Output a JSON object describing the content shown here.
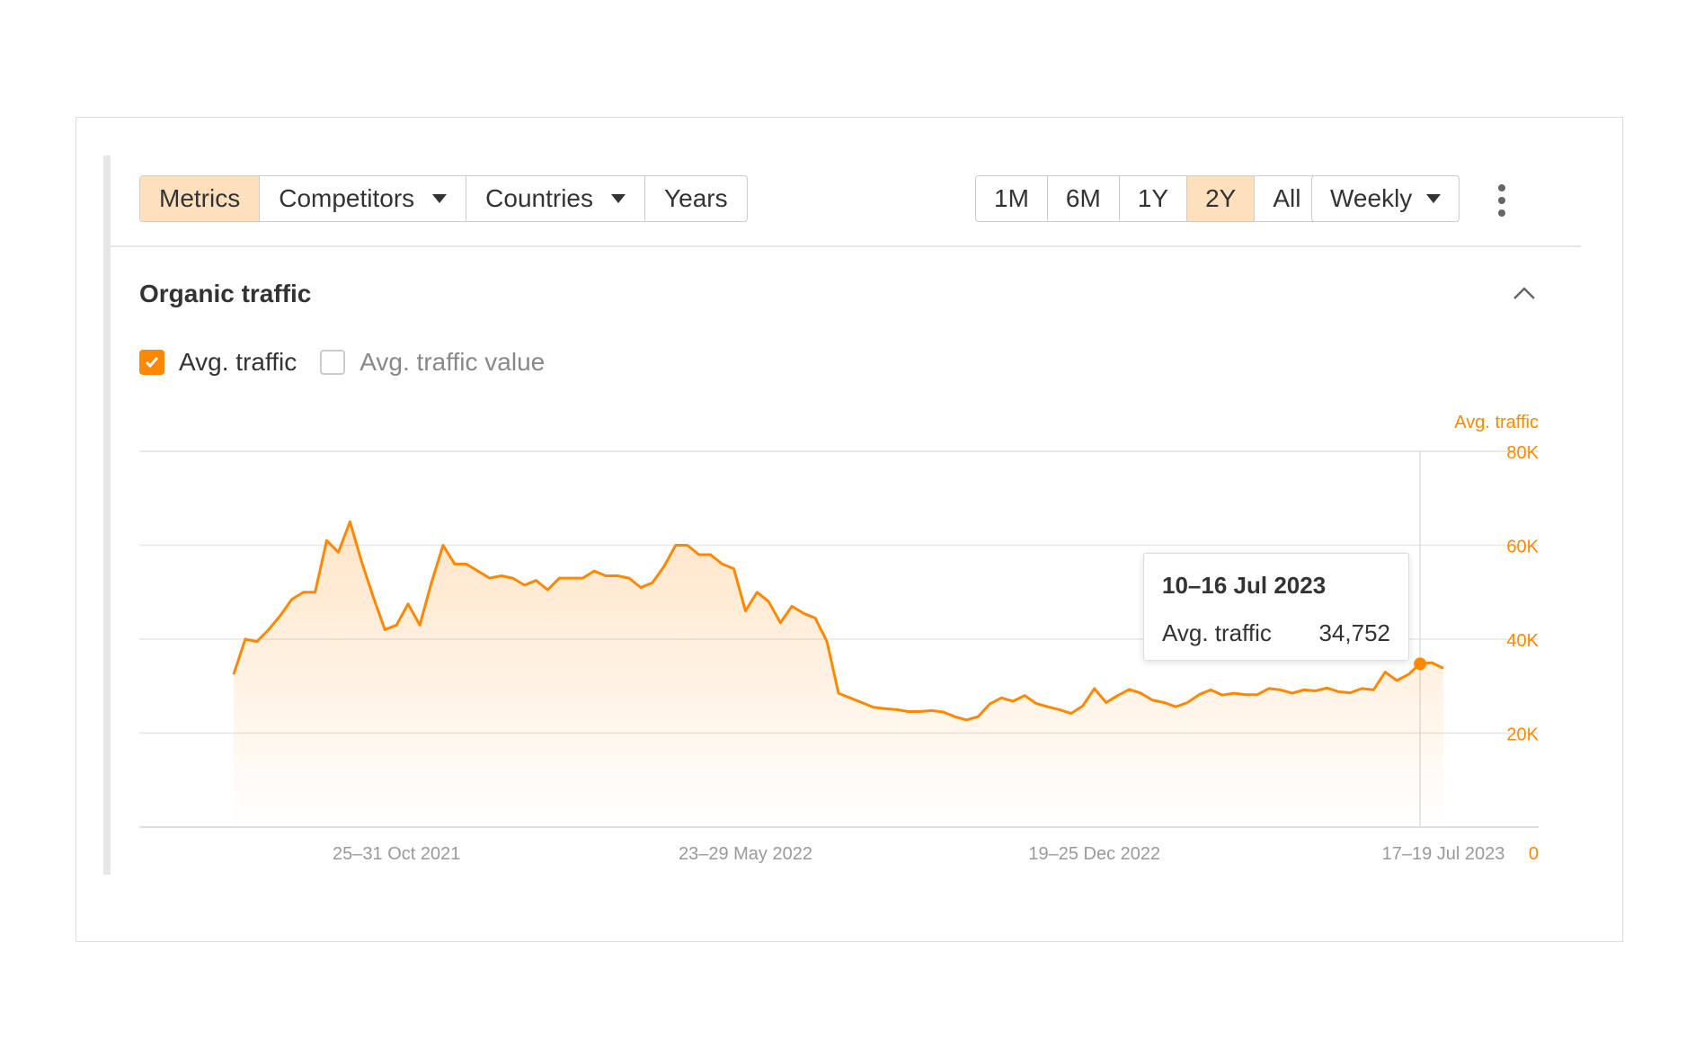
{
  "toolbar": {
    "tabs": [
      {
        "label": "Metrics",
        "active": true,
        "dropdown": false
      },
      {
        "label": "Competitors",
        "active": false,
        "dropdown": true
      },
      {
        "label": "Countries",
        "active": false,
        "dropdown": true
      },
      {
        "label": "Years",
        "active": false,
        "dropdown": false
      }
    ],
    "ranges": [
      {
        "label": "1M",
        "active": false
      },
      {
        "label": "6M",
        "active": false
      },
      {
        "label": "1Y",
        "active": false
      },
      {
        "label": "2Y",
        "active": true
      },
      {
        "label": "All",
        "active": false
      }
    ],
    "interval": "Weekly",
    "more_icon": "vertical-ellipsis-icon"
  },
  "section": {
    "title": "Organic traffic",
    "collapse_icon": "chevron-up-icon"
  },
  "checkboxes": [
    {
      "label": "Avg. traffic",
      "checked": true
    },
    {
      "label": "Avg. traffic value",
      "checked": false
    }
  ],
  "tooltip": {
    "date": "10–16 Jul 2023",
    "label": "Avg. traffic",
    "value": "34,752"
  },
  "colors": {
    "accent": "#ff8800",
    "active_bg": "#fee0bd",
    "grid": "#e6e6e6",
    "tick_text": "#999999"
  },
  "chart_data": {
    "type": "area",
    "ylabel": "Avg. traffic",
    "ylim": [
      0,
      80000
    ],
    "y_ticks": [
      0,
      20000,
      40000,
      60000,
      80000
    ],
    "y_tick_labels": [
      "0",
      "20K",
      "40K",
      "60K",
      "80K"
    ],
    "y_axis_position": "right",
    "x_tick_labels": [
      "25–31 Oct 2021",
      "23–29 May 2022",
      "19–25 Dec 2022",
      "17–19 Jul 2023"
    ],
    "x_tick_indices": [
      14,
      44,
      74,
      104
    ],
    "grid": true,
    "series": [
      {
        "name": "Avg. traffic",
        "color": "#ff8800",
        "values": [
          32500,
          40000,
          39500,
          42000,
          45000,
          48500,
          50000,
          50000,
          61000,
          58500,
          65000,
          56500,
          49000,
          42000,
          43000,
          47500,
          43000,
          52000,
          60000,
          56000,
          56000,
          54500,
          53000,
          53500,
          53000,
          51500,
          52500,
          50500,
          53000,
          53000,
          53000,
          54500,
          53500,
          53500,
          53000,
          51000,
          52000,
          55500,
          60000,
          60000,
          58000,
          58000,
          56000,
          55000,
          46000,
          50000,
          48000,
          43500,
          47000,
          45500,
          44500,
          39500,
          28500,
          27500,
          26500,
          25500,
          25200,
          25000,
          24600,
          24600,
          24800,
          24500,
          23500,
          22800,
          23500,
          26200,
          27500,
          26800,
          28000,
          26300,
          25600,
          25000,
          24200,
          25800,
          29500,
          26500,
          28000,
          29300,
          28500,
          27000,
          26500,
          25600,
          26500,
          28200,
          29200,
          28100,
          28500,
          28200,
          28200,
          29500,
          29200,
          28500,
          29200,
          29000,
          29600,
          28800,
          28600,
          29500,
          29200,
          33000,
          31200,
          32500,
          34752,
          35000,
          33800
        ]
      }
    ],
    "highlight_index": 102
  }
}
